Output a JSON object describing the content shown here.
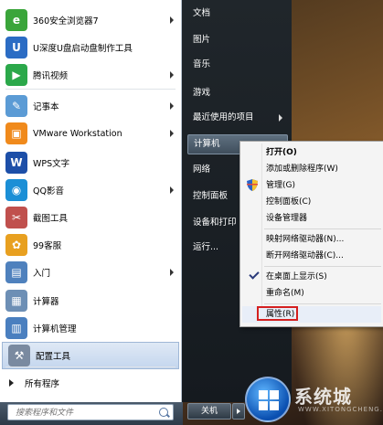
{
  "left_menu": {
    "items": [
      {
        "label": "360安全浏览器7",
        "icon": "browser-360-icon",
        "color": "#3aa53a",
        "glyph": "e",
        "arrow": true
      },
      {
        "label": "U深度U盘启动盘制作工具",
        "icon": "usb-tool-icon",
        "color": "#2b6cc4",
        "glyph": "U",
        "arrow": false
      },
      {
        "label": "腾讯视频",
        "icon": "tencent-video-icon",
        "color": "#2ba84a",
        "glyph": "▶",
        "arrow": true
      },
      {
        "label": "记事本",
        "icon": "notepad-icon",
        "color": "#5b9bd5",
        "glyph": "✎",
        "arrow": true
      },
      {
        "label": "VMware Workstation",
        "icon": "vmware-icon",
        "color": "#f08a1c",
        "glyph": "▣",
        "arrow": true
      },
      {
        "label": "WPS文字",
        "icon": "wps-icon",
        "color": "#1d4fa8",
        "glyph": "W",
        "arrow": false
      },
      {
        "label": "QQ影音",
        "icon": "qq-player-icon",
        "color": "#1b8fd6",
        "glyph": "◉",
        "arrow": true
      },
      {
        "label": "截图工具",
        "icon": "snipping-tool-icon",
        "color": "#c0504d",
        "glyph": "✂",
        "arrow": false
      },
      {
        "label": "99客服",
        "icon": "pinwheel-icon",
        "color": "#e8a020",
        "glyph": "✿",
        "arrow": false
      },
      {
        "label": "入门",
        "icon": "getting-started-icon",
        "color": "#4f81bd",
        "glyph": "▤",
        "arrow": true
      },
      {
        "label": "计算器",
        "icon": "calculator-icon",
        "color": "#6d8fb5",
        "glyph": "▦",
        "arrow": false
      },
      {
        "label": "计算机管理",
        "icon": "computer-management-icon",
        "color": "#4a7fbf",
        "glyph": "▥",
        "arrow": false
      },
      {
        "label": "配置工具",
        "icon": "config-tool-icon",
        "color": "#7a8aa0",
        "glyph": "⚒",
        "arrow": false
      }
    ],
    "all_programs": "所有程序",
    "search_placeholder": "搜索程序和文件"
  },
  "right_menu": {
    "items": [
      {
        "label": "文档",
        "arrow": false
      },
      {
        "label": "图片",
        "arrow": false
      },
      {
        "label": "音乐",
        "arrow": false
      },
      {
        "label": "游戏",
        "arrow": false
      },
      {
        "label": "最近使用的项目",
        "arrow": true
      },
      {
        "label": "计算机",
        "arrow": false
      },
      {
        "label": "网络",
        "arrow": false
      },
      {
        "label": "控制面板",
        "arrow": false
      },
      {
        "label": "设备和打印",
        "arrow": false
      },
      {
        "label": "运行...",
        "arrow": false
      }
    ],
    "shutdown": "关机"
  },
  "context_menu": {
    "items": [
      {
        "label": "打开(O)",
        "bold": true
      },
      {
        "label": "添加或删除程序(W)"
      },
      {
        "label": "管理(G)",
        "shield": true
      },
      {
        "label": "控制面板(C)"
      },
      {
        "label": "设备管理器"
      },
      {
        "label": "映射网络驱动器(N)..."
      },
      {
        "label": "断开网络驱动器(C)..."
      },
      {
        "label": "在桌面上显示(S)",
        "checked": true
      },
      {
        "label": "重命名(M)"
      },
      {
        "label": "属性(R)",
        "selected": true
      }
    ]
  },
  "watermark": {
    "brand": "系统城",
    "url": "WWW.XITONGCHENG.COM"
  }
}
